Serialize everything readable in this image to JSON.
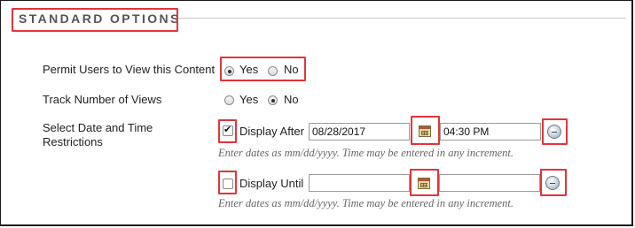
{
  "section": {
    "title": "STANDARD OPTIONS"
  },
  "permit_view": {
    "label": "Permit Users to View this Content",
    "yes_label": "Yes",
    "no_label": "No",
    "selected": "Yes"
  },
  "track_views": {
    "label": "Track Number of Views",
    "yes_label": "Yes",
    "no_label": "No",
    "selected": "No"
  },
  "date_restrictions": {
    "label_line1": "Select Date and Time",
    "label_line2": "Restrictions",
    "display_after": {
      "label": "Display After",
      "checked": true,
      "date_value": "08/28/2017",
      "time_value": "04:30 PM",
      "hint": "Enter dates as mm/dd/yyyy. Time may be entered in any increment."
    },
    "display_until": {
      "label": "Display Until",
      "checked": false,
      "date_value": "",
      "time_value": "",
      "hint": "Enter dates as mm/dd/yyyy. Time may be entered in any increment."
    }
  },
  "icons": {
    "calendar": "calendar-icon",
    "clock": "clock-icon"
  },
  "colors": {
    "highlight": "#e2343b",
    "section_title": "#555555",
    "hint": "#666666"
  }
}
